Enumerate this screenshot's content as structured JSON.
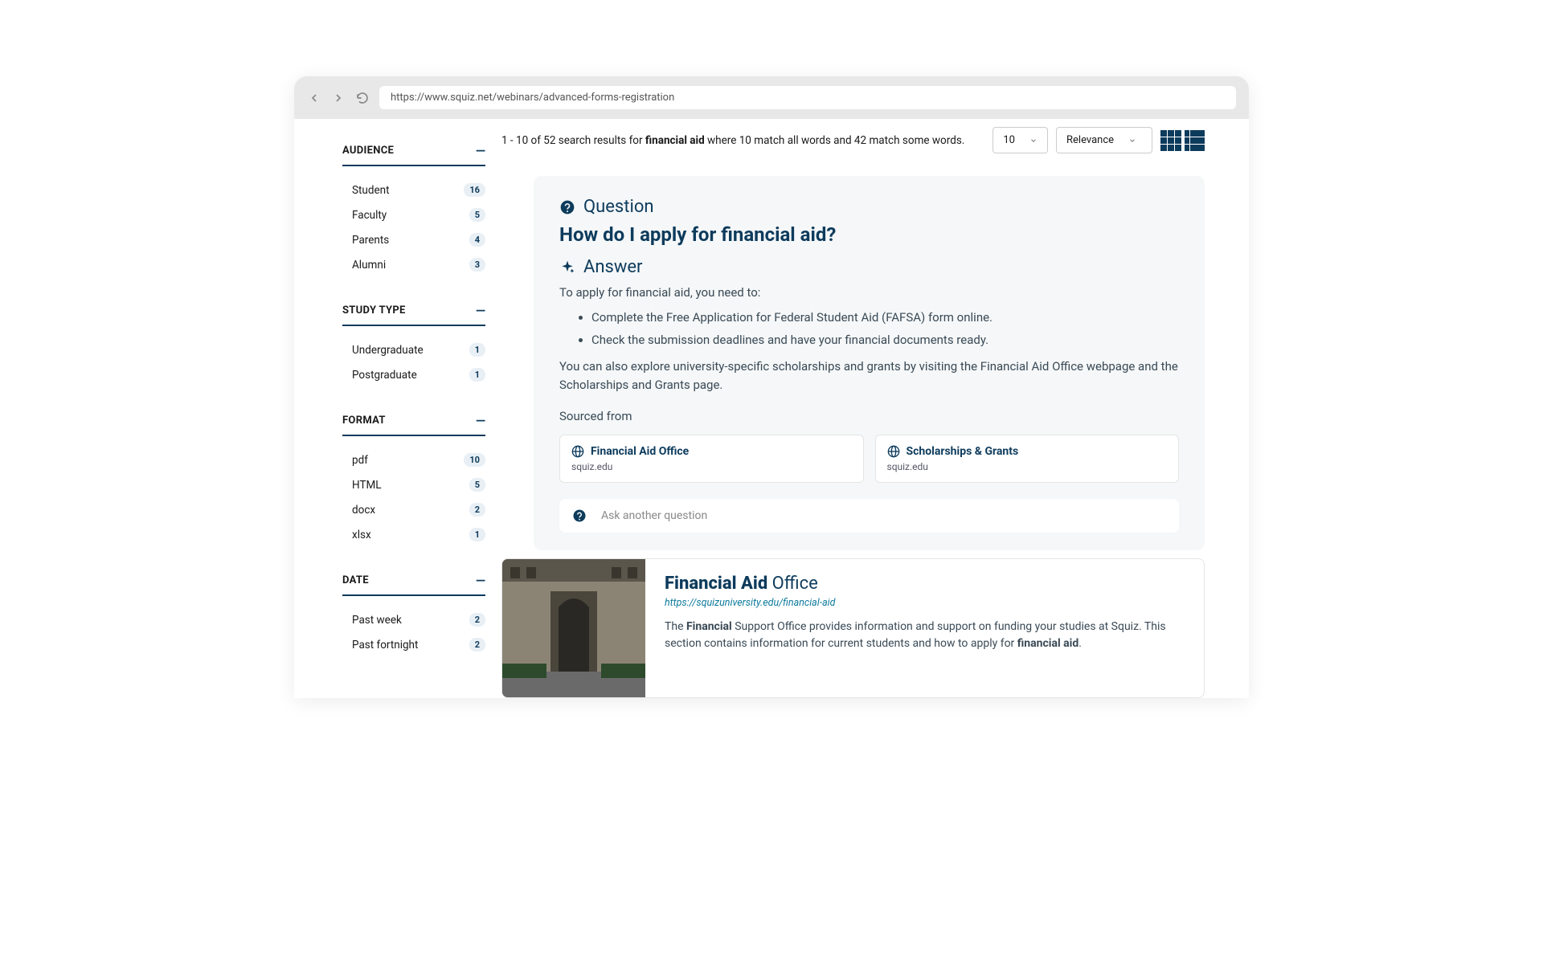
{
  "browser": {
    "url": "https://www.squiz.net/webinars/advanced-forms-registration"
  },
  "summary": {
    "prefix": "1 - 10 of 52 search results for ",
    "term": "financial aid",
    "suffix": " where 10 match all words and 42 match some words."
  },
  "controls": {
    "perPage": "10",
    "sort": "Relevance"
  },
  "facets": [
    {
      "title": "AUDIENCE",
      "items": [
        {
          "label": "Student",
          "count": "16"
        },
        {
          "label": "Faculty",
          "count": "5"
        },
        {
          "label": "Parents",
          "count": "4"
        },
        {
          "label": "Alumni",
          "count": "3"
        }
      ]
    },
    {
      "title": "STUDY TYPE",
      "items": [
        {
          "label": "Undergraduate",
          "count": "1"
        },
        {
          "label": "Postgraduate",
          "count": "1"
        }
      ]
    },
    {
      "title": "FORMAT",
      "items": [
        {
          "label": "pdf",
          "count": "10"
        },
        {
          "label": "HTML",
          "count": "5"
        },
        {
          "label": "docx",
          "count": "2"
        },
        {
          "label": "xlsx",
          "count": "1"
        }
      ]
    },
    {
      "title": "DATE",
      "items": [
        {
          "label": "Past week",
          "count": "2"
        },
        {
          "label": "Past fortnight",
          "count": "2"
        }
      ]
    }
  ],
  "qa": {
    "questionLabel": "Question",
    "question": "How do I apply for financial aid?",
    "answerLabel": "Answer",
    "intro": "To apply for financial aid, you need to:",
    "bullets": [
      "Complete the Free Application for Federal Student Aid (FAFSA) form online.",
      "Check the submission deadlines and have your financial documents ready."
    ],
    "outro": "You can also explore university-specific scholarships and grants by visiting the Financial Aid Office webpage and the Scholarships and Grants page.",
    "sourcedLabel": "Sourced from",
    "sources": [
      {
        "title": "Financial Aid Office",
        "domain": "squiz.edu"
      },
      {
        "title": "Scholarships & Grants",
        "domain": "squiz.edu"
      }
    ],
    "askPlaceholder": "Ask another question"
  },
  "result": {
    "titleBold": "Financial Aid",
    "titleRest": " Office",
    "url": "https://squizuniversity.edu/financial-aid",
    "descParts": [
      "The ",
      "Financial",
      " Support Office provides information and support on funding your studies at Squiz. This section contains information for current students and how to apply for ",
      "financial aid",
      "."
    ]
  }
}
